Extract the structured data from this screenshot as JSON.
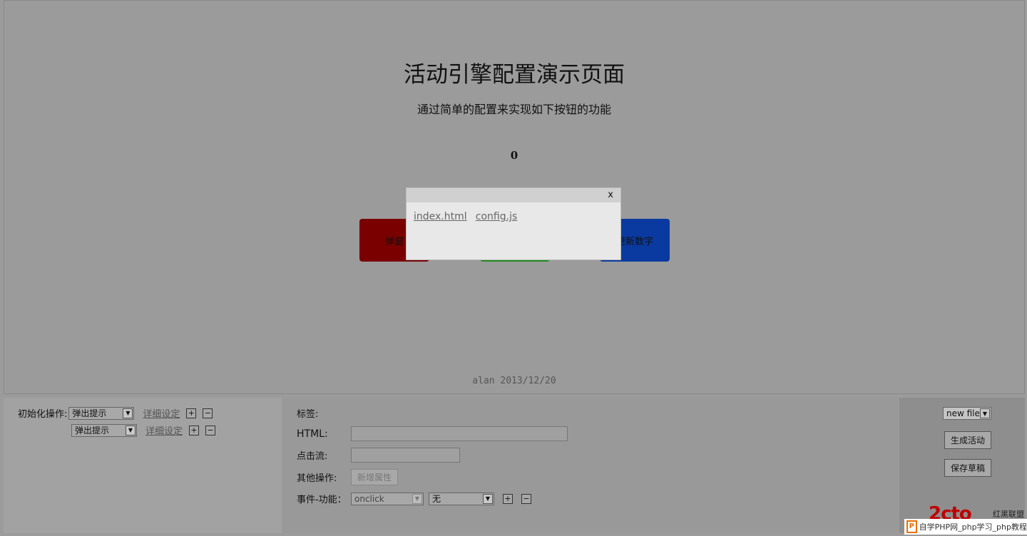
{
  "preview": {
    "title": "活动引擎配置演示页面",
    "subtitle": "通过简单的配置来实现如下按钮的功能",
    "counter": "0",
    "buttons": [
      "弹窗",
      "",
      "更新数字"
    ],
    "credit": "alan 2013/12/20"
  },
  "modal": {
    "close_label": "x",
    "files": [
      "index.html",
      "config.js"
    ]
  },
  "left_panel": {
    "init_label": "初始化操作:",
    "rows": [
      {
        "select_value": "弹出提示",
        "link": "详细设定"
      },
      {
        "select_value": "弹出提示",
        "link": "详细设定"
      }
    ],
    "plus": "+",
    "minus": "−"
  },
  "mid_panel": {
    "tag_label": "标签:",
    "html_label": "HTML:",
    "click_label": "点击流:",
    "other_label": "其他操作:",
    "add_attr_button": "新增属性",
    "event_label": "事件-功能：",
    "event_select": "onclick",
    "func_select": "无",
    "plus": "+",
    "minus": "−"
  },
  "right_panel": {
    "file_select": "new file",
    "generate_button": "生成活动",
    "save_button": "保存草稿"
  },
  "watermark": {
    "logo": "2cto",
    "logo_sub": "红黑联盟",
    "text": "自学PHP网_php学习_php教程"
  },
  "colors": {
    "red_button": "#7a0000",
    "green_button": "#1f8a1f",
    "blue_button": "#0a3aa0"
  }
}
